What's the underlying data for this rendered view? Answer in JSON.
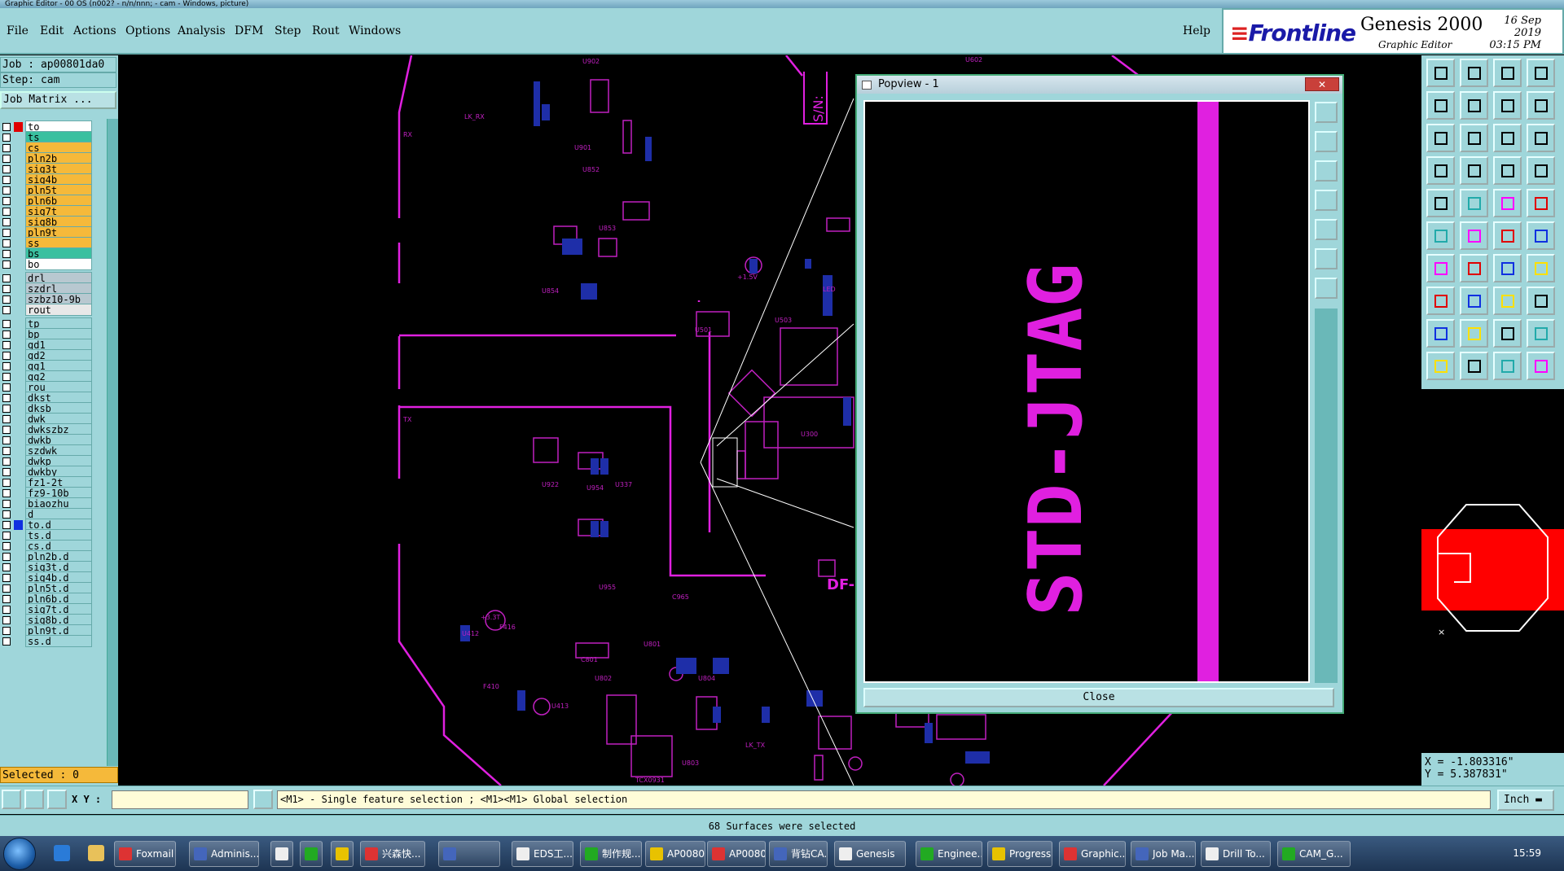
{
  "window": {
    "title": "Graphic Editor - 00 OS (n002? - n/n/nnn; - cam - Windows, picture)"
  },
  "menu": [
    "File",
    "Edit",
    "Actions",
    "Options",
    "Analysis",
    "DFM",
    "Step",
    "Rout",
    "Windows"
  ],
  "help_label": "Help",
  "brand": {
    "logo": "Frontline",
    "product": "Genesis 2000",
    "subtitle": "Graphic Editor",
    "date": "16 Sep 2019",
    "time": "03:15 PM"
  },
  "job": {
    "job_line": "Job : ap00801da0",
    "step_line": "Step: cam",
    "job_matrix_label": "Job Matrix ..."
  },
  "layers": [
    {
      "name": "to",
      "color": "#ffffff",
      "sel": "#e00000",
      "group": 0
    },
    {
      "name": "ts",
      "color": "#3ac0a0",
      "sel": "",
      "group": 0
    },
    {
      "name": "cs",
      "color": "#f5b93a",
      "sel": "",
      "group": 0
    },
    {
      "name": "pln2b",
      "color": "#f5b93a",
      "sel": "",
      "group": 0
    },
    {
      "name": "sig3t",
      "color": "#f5b93a",
      "sel": "",
      "group": 0
    },
    {
      "name": "sig4b",
      "color": "#f5b93a",
      "sel": "",
      "group": 0
    },
    {
      "name": "pln5t",
      "color": "#f5b93a",
      "sel": "",
      "group": 0
    },
    {
      "name": "pln6b",
      "color": "#f5b93a",
      "sel": "",
      "group": 0
    },
    {
      "name": "sig7t",
      "color": "#f5b93a",
      "sel": "",
      "group": 0
    },
    {
      "name": "sig8b",
      "color": "#f5b93a",
      "sel": "",
      "group": 0
    },
    {
      "name": "pln9t",
      "color": "#f5b93a",
      "sel": "",
      "group": 0
    },
    {
      "name": "ss",
      "color": "#f5b93a",
      "sel": "",
      "group": 0
    },
    {
      "name": "bs",
      "color": "#3ac0a0",
      "sel": "",
      "group": 0
    },
    {
      "name": "bo",
      "color": "#ffffff",
      "sel": "",
      "group": 0
    },
    {
      "name": "drl",
      "color": "#b8c8d0",
      "sel": "",
      "group": 1
    },
    {
      "name": "szdrl",
      "color": "#b8c8d0",
      "sel": "",
      "group": 1
    },
    {
      "name": "szbz10-9b",
      "color": "#b8c8d0",
      "sel": "",
      "group": 1
    },
    {
      "name": "rout",
      "color": "#e8e8e8",
      "sel": "",
      "group": 1
    },
    {
      "name": "tp",
      "color": "#9fd6da",
      "sel": "",
      "group": 2
    },
    {
      "name": "bp",
      "color": "#9fd6da",
      "sel": "",
      "group": 2
    },
    {
      "name": "gd1",
      "color": "#9fd6da",
      "sel": "",
      "group": 2
    },
    {
      "name": "gd2",
      "color": "#9fd6da",
      "sel": "",
      "group": 2
    },
    {
      "name": "gg1",
      "color": "#9fd6da",
      "sel": "",
      "group": 2
    },
    {
      "name": "gg2",
      "color": "#9fd6da",
      "sel": "",
      "group": 2
    },
    {
      "name": "rou",
      "color": "#9fd6da",
      "sel": "",
      "group": 2
    },
    {
      "name": "dkst",
      "color": "#9fd6da",
      "sel": "",
      "group": 2
    },
    {
      "name": "dksb",
      "color": "#9fd6da",
      "sel": "",
      "group": 2
    },
    {
      "name": "dwk",
      "color": "#9fd6da",
      "sel": "",
      "group": 2
    },
    {
      "name": "dwkszbz",
      "color": "#9fd6da",
      "sel": "",
      "group": 2
    },
    {
      "name": "dwkb",
      "color": "#9fd6da",
      "sel": "",
      "group": 2
    },
    {
      "name": "szdwk",
      "color": "#9fd6da",
      "sel": "",
      "group": 2
    },
    {
      "name": "dwkp",
      "color": "#9fd6da",
      "sel": "",
      "group": 2
    },
    {
      "name": "dwkby",
      "color": "#9fd6da",
      "sel": "",
      "group": 2
    },
    {
      "name": "fz1-2t",
      "color": "#9fd6da",
      "sel": "",
      "group": 2
    },
    {
      "name": "fz9-10b",
      "color": "#9fd6da",
      "sel": "",
      "group": 2
    },
    {
      "name": "biaozhu",
      "color": "#9fd6da",
      "sel": "",
      "group": 2
    },
    {
      "name": "d",
      "color": "#9fd6da",
      "sel": "",
      "group": 2
    },
    {
      "name": "to.d",
      "color": "#9fd6da",
      "sel": "#1030e0",
      "group": 2
    },
    {
      "name": "ts.d",
      "color": "#9fd6da",
      "sel": "",
      "group": 2
    },
    {
      "name": "cs.d",
      "color": "#9fd6da",
      "sel": "",
      "group": 2
    },
    {
      "name": "pln2b.d",
      "color": "#9fd6da",
      "sel": "",
      "group": 2
    },
    {
      "name": "sig3t.d",
      "color": "#9fd6da",
      "sel": "",
      "group": 2
    },
    {
      "name": "sig4b.d",
      "color": "#9fd6da",
      "sel": "",
      "group": 2
    },
    {
      "name": "pln5t.d",
      "color": "#9fd6da",
      "sel": "",
      "group": 2
    },
    {
      "name": "pln6b.d",
      "color": "#9fd6da",
      "sel": "",
      "group": 2
    },
    {
      "name": "sig7t.d",
      "color": "#9fd6da",
      "sel": "",
      "group": 2
    },
    {
      "name": "sig8b.d",
      "color": "#9fd6da",
      "sel": "",
      "group": 2
    },
    {
      "name": "pln9t.d",
      "color": "#9fd6da",
      "sel": "",
      "group": 2
    },
    {
      "name": "ss.d",
      "color": "#9fd6da",
      "sel": "",
      "group": 2
    }
  ],
  "selected_label": "Selected : 0",
  "canvas_labels": {
    "sn": "S/N:",
    "tx": "TX",
    "rx": "RX",
    "df": "DF-",
    "u602": "U602",
    "u902": "U902",
    "u901": "U901",
    "u852": "U852",
    "u853": "U853",
    "u854": "U854",
    "u501": "U501",
    "u503": "U503",
    "u300": "U300",
    "u922": "U922",
    "u954": "U954",
    "u337": "U337",
    "u955": "U955",
    "u801": "U801",
    "u802": "U802",
    "u803": "U803",
    "u804": "U804",
    "u412": "U412",
    "u413": "U413",
    "v33": "+3.3T",
    "v15": "+1.5V",
    "c965": "C965",
    "c801": "C801",
    "f410": "F410",
    "f416": "F416",
    "tcx": "TCX0931",
    "lkrx": "LK_RX",
    "lktx": "LK_TX",
    "led": "LED"
  },
  "popview": {
    "title": "Popview - 1",
    "close_label": "Close",
    "zoom_text": "STD-JTAG"
  },
  "coords": {
    "x": "X = -1.803316\"",
    "y": "Y = 5.387831\""
  },
  "cmd": {
    "xy_label": "X Y :",
    "message": "<M1> - Single feature selection ; <M1><M1> Global selection",
    "unit": "Inch"
  },
  "status": "68 Surfaces were selected",
  "taskbar": {
    "tasks": [
      "Foxmail",
      "Adminis...",
      "",
      "",
      "",
      "兴森快...",
      "",
      "EDS工...",
      "制作规...",
      "AP0080...",
      "AP0080...",
      "背钻CA...",
      "Genesis",
      "Enginee...",
      "Progress",
      "Graphic...",
      "Job Ma...",
      "Drill To...",
      "CAM_G..."
    ],
    "clock": "15:59"
  }
}
